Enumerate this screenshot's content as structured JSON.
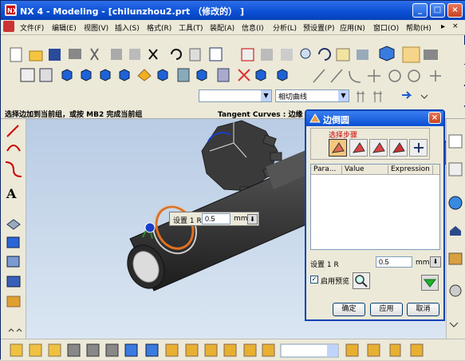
{
  "window": {
    "title": "NX 4 - Modeling - [chilunzhou2.prt （修改的） ]"
  },
  "menu": {
    "items": [
      "文件(F)",
      "编辑(E)",
      "视图(V)",
      "插入(S)",
      "格式(R)",
      "工具(T)",
      "装配(A)",
      "信息(I)",
      "分析(L)",
      "预设置(P)",
      "应用(N)",
      "窗口(O)",
      "帮助(H)"
    ]
  },
  "toolbar": {
    "curve_filter": "相切曲线"
  },
  "status": {
    "prompt": "选择边加到当前组，或按 MB2 完成当前组",
    "selection": "Tangent Curves : 边缘 of"
  },
  "popup": {
    "label": "设置 1 R",
    "value": "0.5",
    "unit": "mm"
  },
  "dialog": {
    "title": "边倒圆",
    "steps_label": "选择步骤",
    "columns": [
      "Para...",
      "Value",
      "Expression"
    ],
    "param_label": "设置 1 R",
    "param_value": "0.5",
    "param_unit": "mm",
    "preview_label": "启用预览",
    "ok": "确定",
    "apply": "应用",
    "cancel": "取消"
  },
  "colors": {
    "title_blue": "#0a4fd4",
    "shaft_dark": "#3a3a3a",
    "fillet_orange": "#e07020"
  }
}
